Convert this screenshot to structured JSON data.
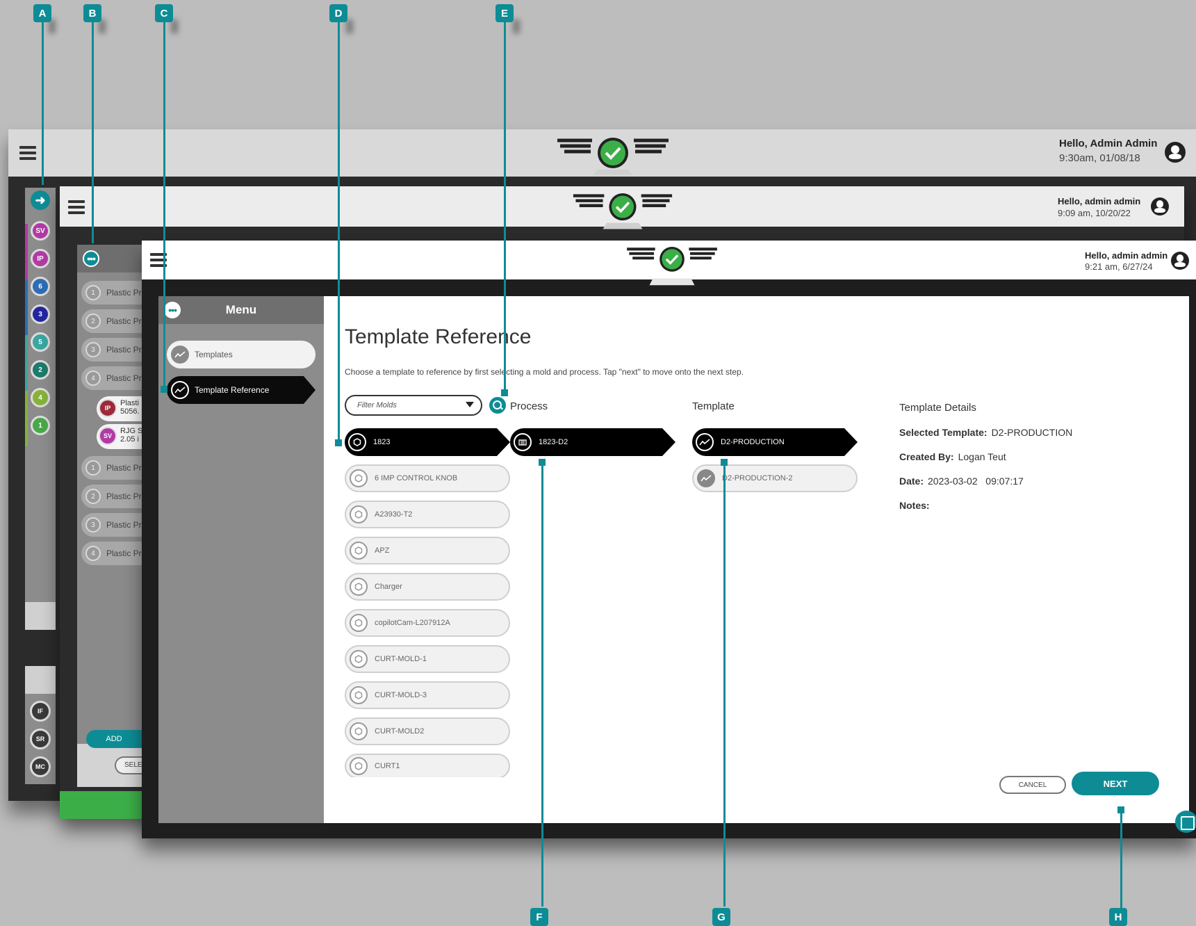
{
  "window_back": {
    "greeting": "Hello, Admin Admin",
    "timestamp": "9:30am, 01/08/18",
    "rail_badges": [
      {
        "label": "SV",
        "color": "#b23aa5"
      },
      {
        "label": "IP",
        "color": "#b23aa5"
      },
      {
        "label": "6",
        "color": "#2d6db5"
      },
      {
        "label": "3",
        "color": "#2426a0"
      },
      {
        "label": "5",
        "color": "#3aa6a0"
      },
      {
        "label": "2",
        "color": "#1e7a6a"
      },
      {
        "label": "4",
        "color": "#86b23a"
      },
      {
        "label": "1",
        "color": "#49a84a"
      }
    ],
    "bottom_badges": [
      "IF",
      "SR",
      "MC"
    ]
  },
  "window_mid": {
    "greeting": "Hello, admin admin",
    "timestamp": "9:09 am, 10/20/22",
    "items": [
      {
        "num": "1",
        "label": "Plastic Pr"
      },
      {
        "num": "2",
        "label": "Plastic Pr"
      },
      {
        "num": "3",
        "label": "Plastic Pr"
      },
      {
        "num": "4",
        "label": "Plastic Pr"
      }
    ],
    "sub_items": [
      {
        "badge": "IP",
        "line1": "Plasti",
        "line2": "5056.",
        "color": "#9c2a3b"
      },
      {
        "badge": "SV",
        "line1": "RJG S",
        "line2": "2.05 i",
        "color": "#b23aa5"
      }
    ],
    "items2": [
      {
        "num": "1",
        "label": "Plastic Pr"
      },
      {
        "num": "2",
        "label": "Plastic Pr"
      },
      {
        "num": "3",
        "label": "Plastic Pr"
      },
      {
        "num": "4",
        "label": "Plastic Pr"
      }
    ],
    "add_label": "ADD",
    "select_label": "SELE"
  },
  "window_front": {
    "greeting": "Hello, admin admin",
    "timestamp": "9:21 am, 6/27/24",
    "menu": {
      "title": "Menu",
      "items": [
        {
          "label": "Templates"
        },
        {
          "label": "Template Reference"
        }
      ]
    },
    "page_title": "Template Reference",
    "page_subtitle": "Choose a template to reference by first selecting a mold and process. Tap \"next\" to move onto the next step.",
    "filter_placeholder": "Filter Molds",
    "molds": [
      "1823",
      "6 IMP CONTROL KNOB",
      "A23930-T2",
      "APZ",
      "Charger",
      "copilotCam-L207912A",
      "CURT-MOLD-1",
      "CURT-MOLD-3",
      "CURT-MOLD2",
      "CURT1"
    ],
    "process_header": "Process",
    "processes": [
      "1823-D2"
    ],
    "template_header": "Template",
    "templates": [
      "D2-PRODUCTION",
      "D2-PRODUCTION-2"
    ],
    "details": {
      "header": "Template Details",
      "selected_label": "Selected Template:",
      "selected_value": "D2-PRODUCTION",
      "created_label": "Created By:",
      "created_value": "Logan Teut",
      "date_label": "Date:",
      "date_value": "2023-03-02   09:07:17",
      "notes_label": "Notes:"
    },
    "cancel_label": "CANCEL",
    "next_label": "NEXT"
  },
  "callouts": [
    "A",
    "B",
    "C",
    "D",
    "E",
    "F",
    "G",
    "H"
  ],
  "colors": {
    "accent": "#0e8c95",
    "status_ok": "#3cae48"
  }
}
